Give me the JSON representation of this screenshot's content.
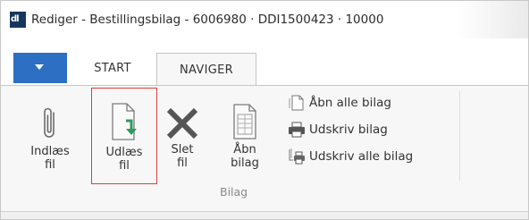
{
  "window": {
    "title": "Rediger - Bestillingsbilag - 6006980 · DDI1500423 · 10000",
    "logo_icon": "dynamics-nav-logo-icon",
    "logo_text": "dl"
  },
  "tabs": {
    "menu_icon": "dropdown-arrow-icon",
    "items": [
      {
        "label": "START",
        "active": false
      },
      {
        "label": "NAVIGER",
        "active": true
      }
    ]
  },
  "ribbon": {
    "group_label": "Bilag",
    "buttons": [
      {
        "label": "Indlæs\nfil",
        "icon": "paperclip-icon",
        "highlighted": false
      },
      {
        "label": "Udlæs\nfil",
        "icon": "export-file-icon",
        "highlighted": true
      },
      {
        "label": "Slet\nfil",
        "icon": "delete-x-icon",
        "highlighted": false
      },
      {
        "label": "Åbn\nbilag",
        "icon": "open-document-icon",
        "highlighted": false
      }
    ],
    "small_buttons": [
      {
        "label": "Åbn alle bilag",
        "icon": "open-all-documents-icon"
      },
      {
        "label": "Udskriv bilag",
        "icon": "printer-icon"
      },
      {
        "label": "Udskriv alle bilag",
        "icon": "print-all-icon"
      }
    ]
  },
  "colors": {
    "accent_tab": "#2d6fc3",
    "highlight_border": "#e23b3b",
    "export_arrow": "#2e9a5a"
  }
}
